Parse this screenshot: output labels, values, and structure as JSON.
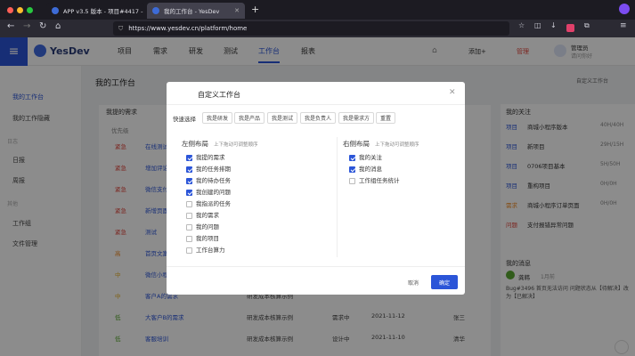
{
  "browser": {
    "tabs": [
      {
        "title": "APP v3.5 版本 - 项目#4417 - Yc"
      },
      {
        "title": "我的工作台 - YesDev"
      }
    ],
    "new_tab": "+",
    "url": "https://www.yesdev.cn/platform/home"
  },
  "app": {
    "logo": "YesDev",
    "nav": [
      "项目",
      "需求",
      "研发",
      "测试",
      "工作台",
      "报表"
    ],
    "active_nav": "工作台",
    "add_label": "添加+",
    "admin_label": "管理",
    "user_name": "管理员",
    "user_sub": "请问你好"
  },
  "sidebar": {
    "items": [
      "我的工作台",
      "我的工作隐藏"
    ],
    "group1": "日志",
    "group1_items": [
      "日报",
      "周报"
    ],
    "group2": "其他",
    "group2_items": [
      "工作组",
      "文件管理"
    ]
  },
  "main": {
    "title": "我的工作台",
    "right_link": "自定义工作台",
    "section": "我提的需求",
    "col_header": "优先级",
    "rows": [
      {
        "priority": "紧急",
        "name": "在线测试"
      },
      {
        "priority": "紧急",
        "name": "增加评论"
      },
      {
        "priority": "紧急",
        "name": "微信支付"
      },
      {
        "priority": "紧急",
        "name": "新增页面"
      },
      {
        "priority": "紧急",
        "name": "测试"
      },
      {
        "priority": "高",
        "name": "首页文案"
      },
      {
        "priority": "中",
        "name": "微信小程序"
      },
      {
        "priority": "中",
        "name": "客户A的需求",
        "project": "研发成本核算示例"
      },
      {
        "priority": "低",
        "name": "大客户B的需求",
        "project": "研发成本核算示例",
        "status": "需求中",
        "date": "2021-11-12",
        "owner": "张三"
      },
      {
        "priority": "低",
        "name": "客服培训",
        "project": "研发成本核算示例",
        "status": "设计中",
        "date": "2021-11-10",
        "owner": "清华"
      }
    ]
  },
  "right": {
    "section1": "我的关注",
    "follows": [
      {
        "tag": "项目",
        "name": "商城小程序版本",
        "count": "40H/40H"
      },
      {
        "tag": "项目",
        "name": "新项目",
        "count": "29H/15H"
      },
      {
        "tag": "项目",
        "name": "0706项目基本",
        "count": "5H/50H"
      },
      {
        "tag": "项目",
        "name": "重构项目",
        "count": "0H/0H"
      },
      {
        "tag": "需求",
        "name": "商城小程序订单页面",
        "count": "0H/0H"
      },
      {
        "tag": "问题",
        "name": "支付报错异常问题",
        "count": ""
      }
    ],
    "section2": "我的消息",
    "msg_user": "龚韩",
    "msg_time": "1月前",
    "msg_text": "Bug#3496 首页无法访问 问题状态从【待解决】改为【已解决】"
  },
  "modal": {
    "title": "自定义工作台",
    "quick_label": "快速选择",
    "quick": [
      "我是研发",
      "我是产品",
      "我是测试",
      "我是负责人",
      "我是需求方",
      "重置"
    ],
    "left_title": "左侧布局",
    "left_hint": "上下拖动可调整顺序",
    "left_items": [
      {
        "label": "我提的需求",
        "checked": true
      },
      {
        "label": "我的任务排期",
        "checked": true
      },
      {
        "label": "我的待办任务",
        "checked": true
      },
      {
        "label": "我创建的问题",
        "checked": true
      },
      {
        "label": "我指派的任务",
        "checked": false
      },
      {
        "label": "我的需求",
        "checked": false
      },
      {
        "label": "我的问题",
        "checked": false
      },
      {
        "label": "我的项目",
        "checked": false
      },
      {
        "label": "工作台算力",
        "checked": false
      }
    ],
    "right_title": "右侧布局",
    "right_hint": "上下拖动可调整顺序",
    "right_items": [
      {
        "label": "我的关注",
        "checked": true
      },
      {
        "label": "我的消息",
        "checked": true
      },
      {
        "label": "工作组任务统计",
        "checked": false
      }
    ],
    "cancel": "取消",
    "ok": "确定"
  },
  "colors": {
    "accent": "#2b55d8",
    "urgent": "#e0453b",
    "high": "#f08a24",
    "mid": "#e8b22b",
    "low": "#5aa832"
  }
}
